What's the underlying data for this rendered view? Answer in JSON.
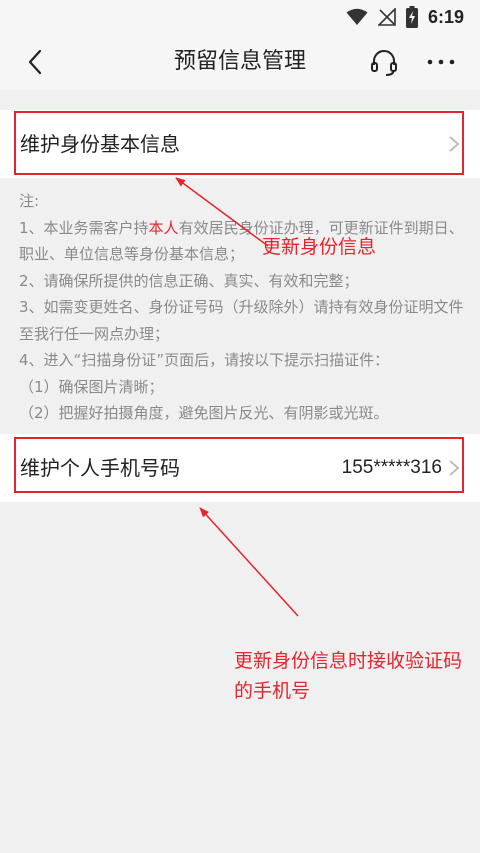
{
  "status_bar": {
    "time": "6:19",
    "icons": [
      "wifi-icon",
      "signal-icon",
      "battery-charging-icon"
    ]
  },
  "header": {
    "title": "预留信息管理",
    "back_icon": "chevron-left-icon",
    "service_icon": "headset-icon",
    "more_icon": "more-dots-icon"
  },
  "items": [
    {
      "label": "维护身份基本信息",
      "value": ""
    },
    {
      "label": "维护个人手机号码",
      "value": "155*****316"
    }
  ],
  "notes": {
    "title": "注:",
    "line1_before": "1、本业务需客户持",
    "line1_highlight": "本人",
    "line1_after": "有效居民身份证办理，可更新证件到期日、职业、单位信息等身份基本信息；",
    "line2": "2、请确保所提供的信息正确、真实、有效和完整；",
    "line3": "3、如需变更姓名、身份证号码（升级除外）请持有效身份证明文件至我行任一网点办理；",
    "line4": "4、进入“扫描身份证”页面后，请按以下提示扫描证件：",
    "line5": "（1）确保图片清晰；",
    "line6": "（2）把握好拍摄角度，避免图片反光、有阴影或光斑。"
  },
  "annotations": {
    "update_id": "更新身份信息",
    "phone_note": "更新身份信息时接收验证码的手机号"
  },
  "colors": {
    "highlight_red": "#e6242e",
    "background": "#f0f0f0",
    "note_gray": "#8a8a8a"
  }
}
